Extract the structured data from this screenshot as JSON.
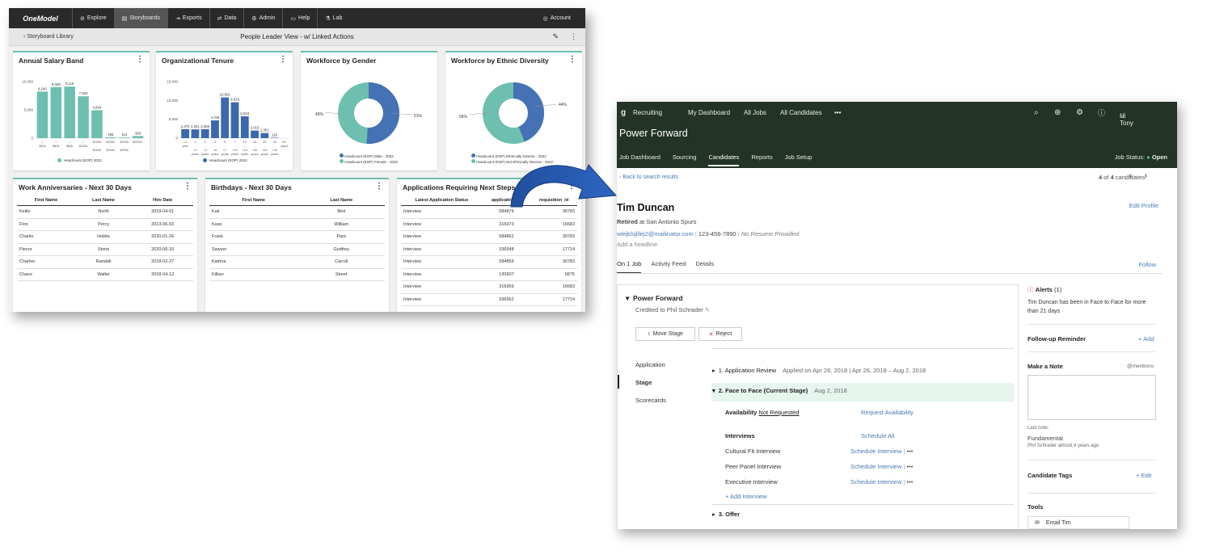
{
  "onemodel": {
    "logo": "OneModel",
    "nav": [
      "Explore",
      "Storyboards",
      "Exports",
      "Data",
      "Admin",
      "Help",
      "Lab"
    ],
    "account": "Account",
    "back": "Storyboard Library",
    "title": "People Leader View - w/ Linked Actions",
    "salary_card": {
      "title": "Annual Salary Band",
      "legend": "Headcount (EOP) 2022",
      "y_ticks": [
        "10,000",
        "5,000",
        "0"
      ],
      "categories": [
        "< $40k",
        "< $60k",
        "< $80k",
        "< $100k",
        "$100k - $150k",
        "$150k - $200k",
        "$200k - $250k",
        "$250k+"
      ],
      "values": [
        8240,
        9028,
        9119,
        7403,
        4934,
        156,
        113,
        383
      ],
      "labels": [
        "8,240",
        "9,028",
        "9,119",
        "7,403",
        "4,934",
        "156",
        "113",
        "383"
      ]
    },
    "tenure_card": {
      "title": "Organizational Tenure",
      "legend": "Headcount (EOP) 2022",
      "y_ticks": [
        "15,000",
        "10,000",
        "5,000",
        "0"
      ],
      "categories": [
        "<1 year",
        "1 - <2 years",
        "2 - <3 years",
        "3 - <5 years",
        "5 - <7 years",
        "7 - <10 years",
        "10 - <15 years",
        "15 - <20 years",
        "20 - <25 years",
        "25 - <30 years",
        "30+ years"
      ],
      "values": [
        2374,
        2321,
        2369,
        4709,
        10801,
        9519,
        5810,
        2015,
        1351,
        116
      ],
      "labels": [
        "2,374",
        "2,321",
        "2,369",
        "4,709",
        "10,801",
        "9,519",
        "5,810",
        "2,015",
        "1,351",
        "116"
      ]
    },
    "gender_card": {
      "title": "Workforce by Gender",
      "pct_left": "49%",
      "pct_right": "51%",
      "legend": [
        "Headcount (EOP) Male - 2022",
        "Headcount (EOP) Female - 2022"
      ]
    },
    "ethnic_card": {
      "title": "Workforce by Ethnic Diversity",
      "pct_left": "56%",
      "pct_right": "44%",
      "legend": [
        "Headcount (EOP) Ethnically Diverse - 2022",
        "Headcount (EOP) Not Ethnically Diverse - 2022"
      ]
    },
    "anniv_card": {
      "title": "Work Anniversaries - Next 30 Days",
      "columns": [
        "First Name",
        "Last Name",
        "Hire Date"
      ],
      "rows": [
        [
          "Kellie",
          "North",
          "2019-04-01"
        ],
        [
          "Finn",
          "Percy",
          "2013-06-03"
        ],
        [
          "Charlie",
          "Hobbs",
          "2020-01-26"
        ],
        [
          "Pierce",
          "Storie",
          "2020-06-16"
        ],
        [
          "Charlee",
          "Randall",
          "2018-02-27"
        ],
        [
          "Chace",
          "Walter",
          "2018-04-12"
        ]
      ]
    },
    "bday_card": {
      "title": "Birthdays - Next 30 Days",
      "columns": [
        "First Name",
        "Last Name"
      ],
      "rows": [
        [
          "Kali",
          "Bird"
        ],
        [
          "Kase",
          "William"
        ],
        [
          "Frank",
          "Pare"
        ],
        [
          "Sawyer",
          "Godfrey"
        ],
        [
          "Katrina",
          "Carroll"
        ],
        [
          "Killian",
          "Street"
        ]
      ]
    },
    "apps_card": {
      "title": "Applications Requiring Next Steps",
      "columns": [
        "Latest Application Status",
        "application_id",
        "requisition_id"
      ],
      "rows": [
        [
          "Interview",
          "584876",
          "30783"
        ],
        [
          "Interview",
          "316973",
          "16683"
        ],
        [
          "Interview",
          "584862",
          "30783"
        ],
        [
          "Interview",
          "336548",
          "17714"
        ],
        [
          "Interview",
          "584859",
          "30783"
        ],
        [
          "Interview",
          "130607",
          "6875"
        ],
        [
          "Interview",
          "316959",
          "16683"
        ],
        [
          "Interview",
          "336562",
          "17714"
        ]
      ]
    }
  },
  "greenhouse": {
    "product": "Recruiting",
    "nav": [
      "My Dashboard",
      "All Jobs",
      "All Candidates"
    ],
    "more": "•••",
    "user": "Hi Tony",
    "job_title": "Power Forward",
    "tabs": [
      "Job Dashboard",
      "Sourcing",
      "Candidates",
      "Reports",
      "Job Setup"
    ],
    "job_status_label": "Job Status:",
    "job_status": "Open",
    "back": "Back to search results",
    "pager_num": "4",
    "pager_of": "of",
    "pager_total": "4",
    "pager_suffix": "candidates",
    "candidate": {
      "name": "Tim Duncan",
      "edit": "Edit Profile",
      "retired": "Retired",
      "at": "at San Antonio Spurs",
      "email": "wlejklsjlilej2@mailinator.com",
      "phone": "123-456-7890",
      "resume": "No Resume Provided",
      "headline": "Add a headline"
    },
    "subtabs": [
      "On 1 Job",
      "Activity Feed",
      "Details"
    ],
    "follow": "Follow",
    "job": {
      "title": "Power Forward",
      "credited": "Credited to Phil Schrader",
      "move": "Move Stage",
      "reject": "Reject",
      "side": [
        "Application",
        "Stage",
        "Scorecards"
      ],
      "stage1": "1.  Application Review",
      "stage1_meta": "Applied on Apr 26, 2018 | Apr 26, 2018 – Aug 2, 2018",
      "stage2": "2.  Face to Face (Current Stage)",
      "stage2_meta": "Aug 2, 2018",
      "availability": "Availability",
      "not_requested": "Not Requested",
      "request_avail": "Request Availability",
      "interviews": "Interviews",
      "schedule_all": "Schedule All",
      "interview_list": [
        "Cultural Fit Interview",
        "Peer Panel Interview",
        "Executive Interview"
      ],
      "schedule": "Schedule Interview",
      "add_interview": "+ Add Interview",
      "stage3": "3.  Offer"
    },
    "right": {
      "alerts": "Alerts",
      "alerts_count": "(1)",
      "alert_text": "Tim Duncan has been in Face to Face for more than 21 days",
      "followup": "Follow-up Reminder",
      "add": "+ Add",
      "note": "Make a Note",
      "mentions": "@mentions",
      "last_note": "Last note:",
      "last_note_text": "Fundamental",
      "note_by": "Phil Schrader almost 4 years ago",
      "tags": "Candidate Tags",
      "edit": "+ Edit",
      "tools": "Tools",
      "email": "Email Tim"
    }
  }
}
